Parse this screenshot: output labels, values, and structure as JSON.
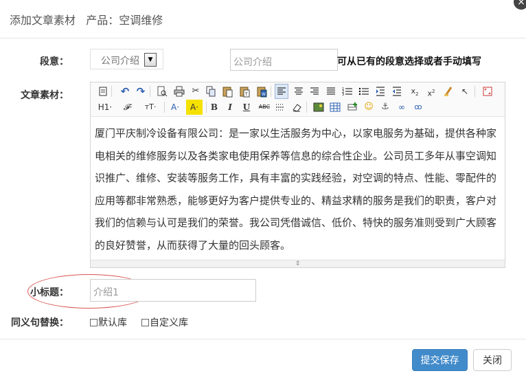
{
  "dialog": {
    "title": "添加文章素材   产品：空调维修",
    "close_icon": "close-icon"
  },
  "form": {
    "segment_label": "段意：",
    "segment_select_value": "公司介绍",
    "segment_input_value": "公司介绍",
    "segment_hint": "可从已有的段意选择或者手动填写",
    "material_label": "文章素材：",
    "subtitle_label": "小标题：",
    "subtitle_input_value": "介绍1",
    "synonym_label": "同义句替换：",
    "synonym_options": [
      "默认库",
      "自定义库"
    ]
  },
  "editor": {
    "toolbar_row1": [
      "source-icon",
      "undo-icon",
      "redo-icon",
      "preview-icon",
      "print-icon",
      "cut-icon",
      "copy-icon",
      "paste-icon",
      "paste-text-icon",
      "paste-word-icon",
      "align-left-icon",
      "align-center-icon",
      "align-right-icon",
      "justify-icon",
      "ordered-list-icon",
      "unordered-list-icon",
      "indent-icon",
      "outdent-icon",
      "subscript-icon",
      "superscript-icon",
      "clear-format-icon",
      "select-all-icon",
      "fullscreen-icon"
    ],
    "toolbar_row2_labels": {
      "heading": "H1·",
      "font_family": "𝓕·",
      "font_size": "тT·",
      "font_color": "A·",
      "highlight": "A·",
      "bold": "B",
      "italic": "I",
      "underline": "U",
      "strikethrough": "ABC"
    },
    "content": "厦门平庆制冷设备有限公司：是一家以生活服务为中心，以家电服务为基础，提供各种家电相关的维修服务以及各类家电使用保养等信息的综合性企业。公司员工多年从事空调知识推广、维修、安装等服务工作，具有丰富的实践经验，对空调的特点、性能、零配件的应用等都非常熟悉，能够更好为客户提供专业的、精益求精的服务是我们的职责，客户对我们的信赖与认可是我们的荣誉。我公司凭借诚信、低价、特快的服务准则受到广大顾客的良好赞誉，从而获得了大量的回头顾客。"
  },
  "footer": {
    "submit_label": "提交保存",
    "close_label": "关闭"
  },
  "colors": {
    "primary": "#428bca",
    "highlight_ellipse": "#d9534f"
  }
}
